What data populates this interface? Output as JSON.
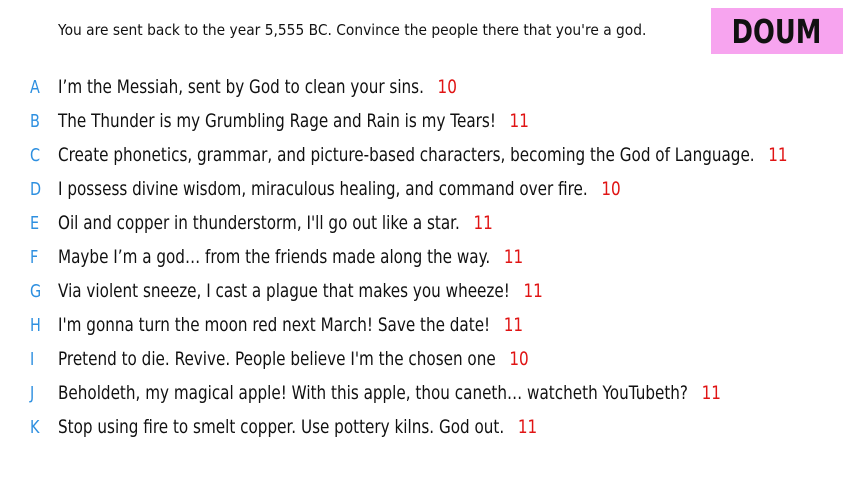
{
  "prompt": "You are sent back to the year 5,555 BC. Convince the people there that you're a god.",
  "brand": "DOUM",
  "colors": {
    "brand_bg": "#f7a4ef",
    "letter": "#2d8fe0",
    "score": "#e01414",
    "text": "#111111"
  },
  "answers": [
    {
      "letter": "A",
      "text": "I’m the Messiah, sent by God to clean your sins.",
      "score": "10"
    },
    {
      "letter": "B",
      "text": "The Thunder is my Grumbling Rage and Rain is my Tears!",
      "score": "11"
    },
    {
      "letter": "C",
      "text": "Create phonetics, grammar, and picture-based characters, becoming the God of Language.",
      "score": "11"
    },
    {
      "letter": "D",
      "text": "I possess divine wisdom, miraculous healing, and command over fire.",
      "score": "10"
    },
    {
      "letter": "E",
      "text": "Oil and copper in thunderstorm, I'll go out like a star.",
      "score": "11"
    },
    {
      "letter": "F",
      "text": "Maybe I’m a god… from the friends made along the way.",
      "score": "11"
    },
    {
      "letter": "G",
      "text": "Via violent sneeze, I cast a plague that makes you wheeze!",
      "score": "11"
    },
    {
      "letter": "H",
      "text": "I'm gonna turn the moon red next March! Save the date!",
      "score": "11"
    },
    {
      "letter": "I",
      "text": "Pretend to die. Revive. People believe I'm the chosen one",
      "score": "10"
    },
    {
      "letter": "J",
      "text": "Beholdeth, my magical apple! With this apple, thou caneth… watcheth YouTubeth?",
      "score": "11"
    },
    {
      "letter": "K",
      "text": "Stop using fire to smelt copper. Use pottery kilns. God out.",
      "score": "11"
    }
  ]
}
